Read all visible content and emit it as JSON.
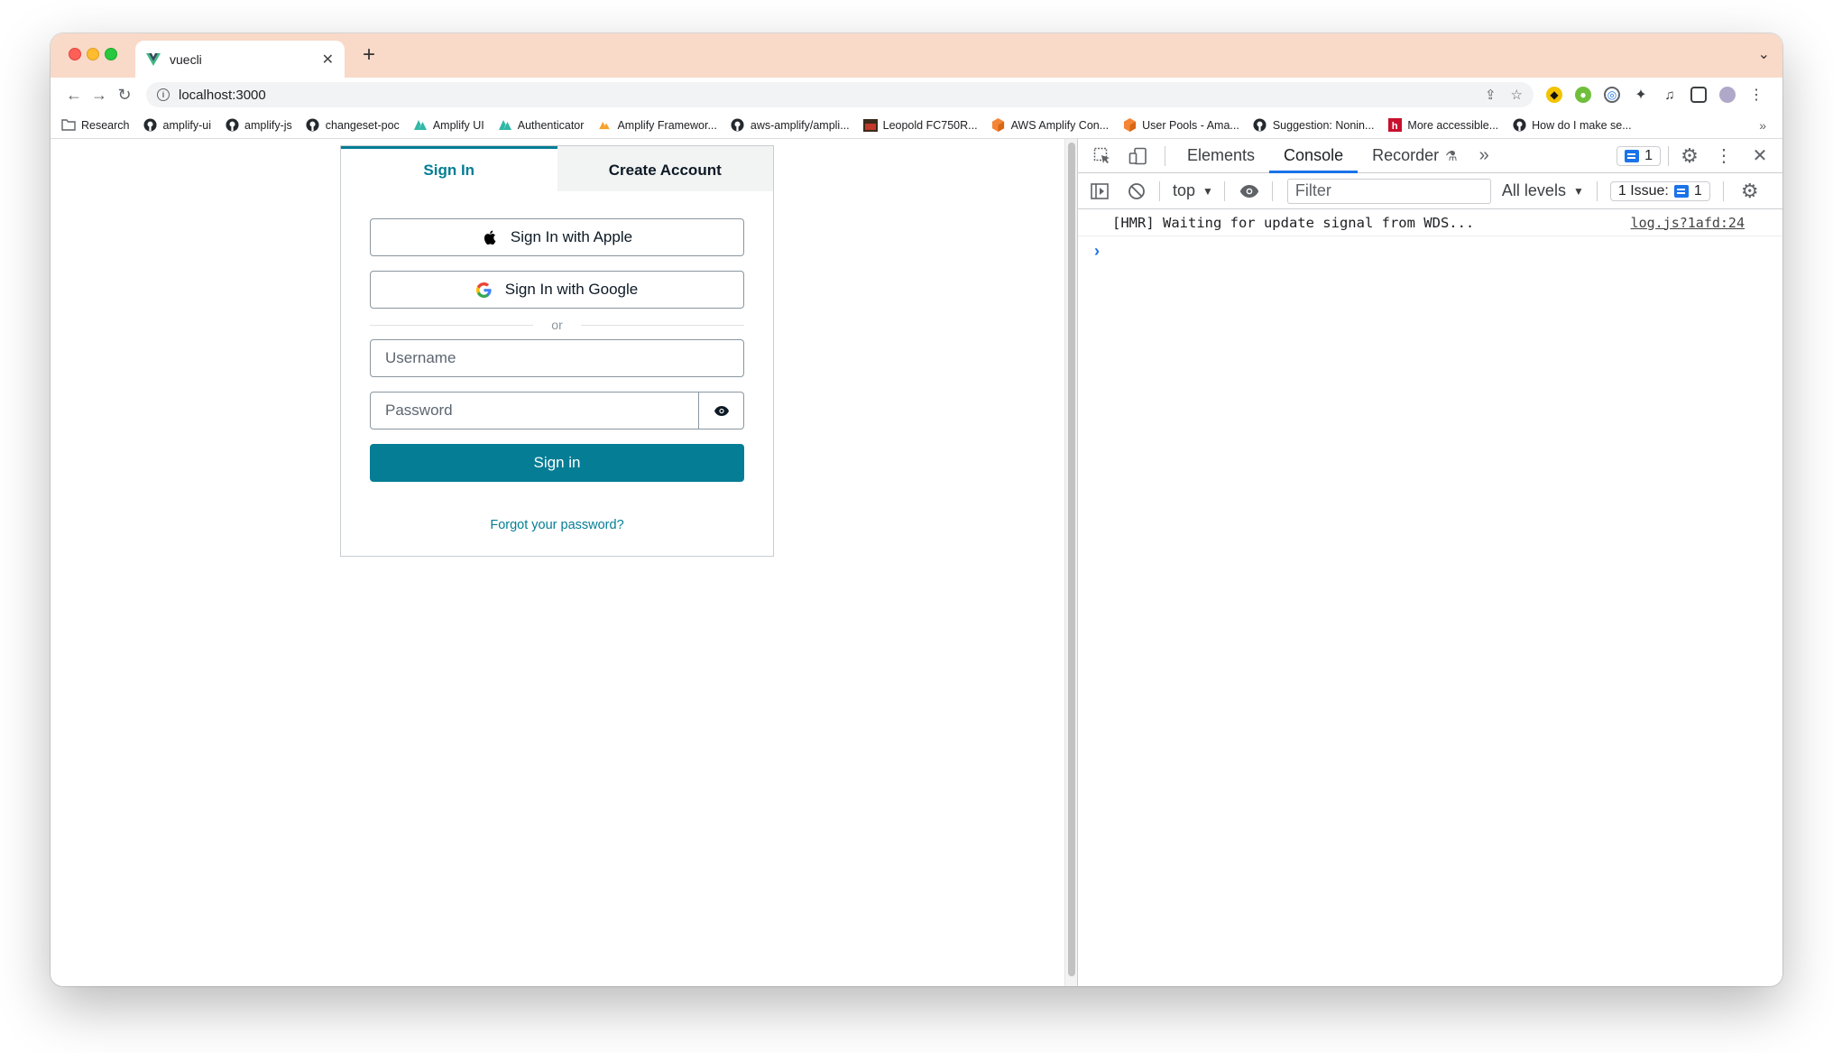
{
  "browser": {
    "tab_title": "vuecli",
    "new_tab": "+",
    "url": "localhost:3000"
  },
  "bookmarks": [
    {
      "label": "Research",
      "icon": "folder-icon"
    },
    {
      "label": "amplify-ui",
      "icon": "github-icon"
    },
    {
      "label": "amplify-js",
      "icon": "github-icon"
    },
    {
      "label": "changeset-poc",
      "icon": "github-icon"
    },
    {
      "label": "Amplify UI",
      "icon": "amplify-icon"
    },
    {
      "label": "Authenticator",
      "icon": "amplify-icon"
    },
    {
      "label": "Amplify Framewor...",
      "icon": "amplify-orange-icon"
    },
    {
      "label": "aws-amplify/ampli...",
      "icon": "github-icon"
    },
    {
      "label": "Leopold FC750R...",
      "icon": "leopold-icon"
    },
    {
      "label": "AWS Amplify Con...",
      "icon": "aws-cube-icon"
    },
    {
      "label": "User Pools - Ama...",
      "icon": "aws-cube-icon"
    },
    {
      "label": "Suggestion: Nonin...",
      "icon": "github-icon"
    },
    {
      "label": "More accessible...",
      "icon": "h-icon"
    },
    {
      "label": "How do I make se...",
      "icon": "github-icon"
    }
  ],
  "bookmarks_more": "»",
  "auth": {
    "tab_signin": "Sign In",
    "tab_create": "Create Account",
    "apple_label": "Sign In with Apple",
    "google_label": "Sign In with Google",
    "divider": "or",
    "username_placeholder": "Username",
    "password_placeholder": "Password",
    "signin_button": "Sign in",
    "forgot": "Forgot your password?",
    "accent_color": "#047d95"
  },
  "devtools": {
    "tabs": [
      "Elements",
      "Console",
      "Recorder"
    ],
    "active_tab": "Console",
    "more": "»",
    "message_count": "1",
    "context": "top",
    "filter_placeholder": "Filter",
    "levels": "All levels",
    "issues_label": "1 Issue:",
    "issues_count": "1",
    "console_message": "[HMR] Waiting for update signal from WDS...",
    "console_source": "log.js?1afd:24",
    "prompt": "›"
  }
}
